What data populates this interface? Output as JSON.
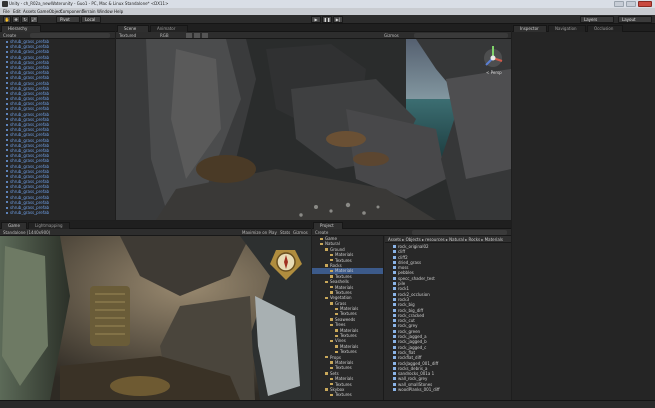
{
  "window": {
    "title": "Unity - ch_R02a_newWaterunity - Guo1 - PC, Mac & Linux Standalone* <DX11>"
  },
  "menu": [
    "File",
    "Edit",
    "Assets",
    "GameObject",
    "Component",
    "Terrain",
    "Window",
    "Help"
  ],
  "toolbar": {
    "pivot_label": "Pivot",
    "local_label": "Local",
    "layers_label": "Layers",
    "layout_label": "Layout"
  },
  "hierarchy": {
    "tab": "Hierarchy",
    "create_label": "Create",
    "items": [
      "shrub_grass_prefab",
      "shrub_grass_prefab",
      "shrub_grass_prefab",
      "shrub_grass_prefab",
      "shrub_grass_prefab",
      "shrub_grass_prefab",
      "shrub_grass_prefab",
      "shrub_grass_prefab",
      "shrub_grass_prefab",
      "shrub_grass_prefab",
      "shrub_grass_prefab",
      "shrub_grass_prefab",
      "shrub_grass_prefab",
      "shrub_grass_prefab",
      "shrub_grass_prefab",
      "shrub_grass_prefab",
      "shrub_grass_prefab",
      "shrub_grass_prefab",
      "shrub_grass_prefab",
      "shrub_grass_prefab",
      "shrub_grass_prefab",
      "shrub_grass_prefab",
      "shrub_grass_prefab",
      "shrub_grass_prefab",
      "shrub_grass_prefab",
      "shrub_grass_prefab",
      "shrub_grass_prefab",
      "shrub_grass_prefab",
      "shrub_grass_prefab",
      "shrub_grass_prefab",
      "shrub_grass_prefab",
      "shrub_grass_prefab",
      "shrub_grass_prefab",
      "shrub_grass_prefab"
    ]
  },
  "scene": {
    "tab_scene": "Scene",
    "tab_animator": "Animator",
    "shading": "Textured",
    "rgb": "RGB",
    "gizmos": "Gizmos",
    "search_placeholder": "All",
    "persp": "< Persp"
  },
  "right_tabs": {
    "inspector": "Inspector",
    "navigation": "Navigation",
    "occlusion": "Occlusion"
  },
  "game": {
    "tab_game": "Game",
    "tab_lightmapping": "Lightmapping",
    "aspect": "Standalone (1440x900)",
    "maximize": "Maximize on Play",
    "stats": "Stats",
    "gizmos": "Gizmos"
  },
  "project": {
    "tab": "Project",
    "create_label": "Create",
    "breadcrumb": "Assets ▸ Objects ▸ resources ▸ Natural ▸ Rocks ▸ Materials",
    "tree": [
      {
        "label": "Game",
        "indent": 1
      },
      {
        "label": "Natural",
        "indent": 1
      },
      {
        "label": "Ground",
        "indent": 2
      },
      {
        "label": "Materials",
        "indent": 3
      },
      {
        "label": "Textures",
        "indent": 3
      },
      {
        "label": "Rocks",
        "indent": 2
      },
      {
        "label": "Materials",
        "indent": 3,
        "selected": true
      },
      {
        "label": "Textures",
        "indent": 3
      },
      {
        "label": "Seashells",
        "indent": 2
      },
      {
        "label": "Materials",
        "indent": 3
      },
      {
        "label": "Textures",
        "indent": 3
      },
      {
        "label": "Vegetation",
        "indent": 2
      },
      {
        "label": "Grass",
        "indent": 3
      },
      {
        "label": "Materials",
        "indent": 4
      },
      {
        "label": "Textures",
        "indent": 4
      },
      {
        "label": "Seaweeds",
        "indent": 3
      },
      {
        "label": "Trees",
        "indent": 3
      },
      {
        "label": "Materials",
        "indent": 4
      },
      {
        "label": "Textures",
        "indent": 4
      },
      {
        "label": "Vines",
        "indent": 3
      },
      {
        "label": "Materials",
        "indent": 4
      },
      {
        "label": "Textures",
        "indent": 4
      },
      {
        "label": "Props",
        "indent": 2
      },
      {
        "label": "Materials",
        "indent": 3
      },
      {
        "label": "Textures",
        "indent": 3
      },
      {
        "label": "Sets",
        "indent": 2
      },
      {
        "label": "Materials",
        "indent": 3
      },
      {
        "label": "Textures",
        "indent": 3
      },
      {
        "label": "Skybox",
        "indent": 2
      },
      {
        "label": "Textures",
        "indent": 3
      }
    ],
    "files": [
      "rock_original02",
      "cliff",
      "cliff2",
      "dried_grass",
      "moss",
      "pebbles",
      "specc_shader_test",
      "pile",
      "rock1",
      "rock2_occlusion",
      "rock3",
      "rock_big",
      "rock_big_diff",
      "rock_cracked",
      "rock_cut",
      "rock_grey",
      "rock_green",
      "rock_jagged_a",
      "rock_jagged_b",
      "rock_jagged_c",
      "rock_flat",
      "rockflat_diff",
      "rockJagged_001_diff",
      "rocks_debris_a",
      "sandrocks_001a 1",
      "wall_rock_grey",
      "wall_smallStones",
      "woodPlanks_001_diff"
    ]
  }
}
